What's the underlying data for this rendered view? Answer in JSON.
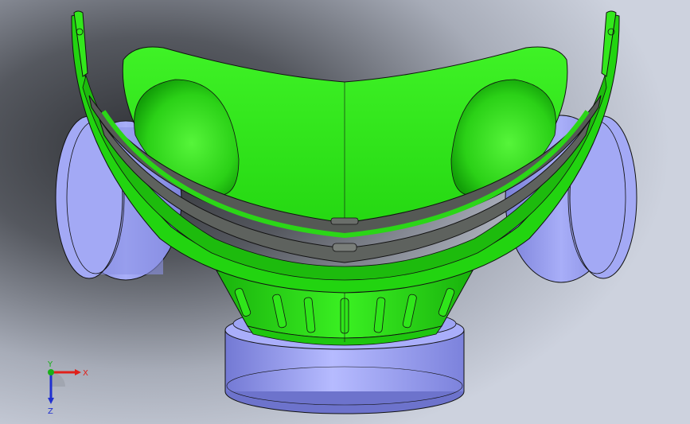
{
  "viewport": {
    "colors": {
      "background_light": "#c9cfdc",
      "background_dark": "#3d4046",
      "mask_green": "#33ee1a",
      "mask_green_dark": "#16a80c",
      "filter_blue": "#9aa0f0",
      "filter_blue_dark": "#6a70c8",
      "strap_gray": "#5a5e5a",
      "edge_black": "#111111"
    }
  },
  "triad": {
    "x_label": "X",
    "y_label": "Y",
    "z_label": "Z",
    "x_color": "#e0201a",
    "y_color": "#18b018",
    "z_color": "#2030d0"
  }
}
